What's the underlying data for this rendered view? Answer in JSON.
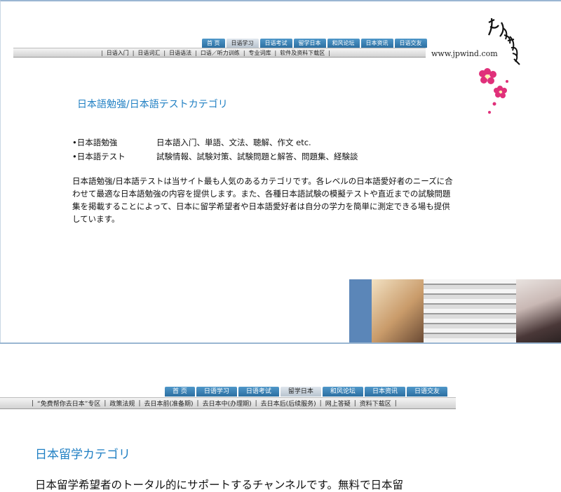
{
  "colors": {
    "tab_blue": "#2c6fa1",
    "heading_blue": "#1f7fc3",
    "blossom_pink": "#e0307a"
  },
  "logo": {
    "url_text": "www.jpwind.com"
  },
  "panel1": {
    "nav_tabs": [
      {
        "label": "首  页",
        "active": false
      },
      {
        "label": "日语学习",
        "active": true
      },
      {
        "label": "日语考试",
        "active": false
      },
      {
        "label": "留学日本",
        "active": false
      },
      {
        "label": "和风论坛",
        "active": false
      },
      {
        "label": "日本资讯",
        "active": false
      },
      {
        "label": "日语交友",
        "active": false
      }
    ],
    "sub_links": [
      "日语入门",
      "日语词汇",
      "日语语法",
      "口语／听力训练",
      "专业词库",
      "软件及资料下载区"
    ],
    "heading": "日本語勉強/日本語テストカテゴリ",
    "bullets": [
      {
        "label": "•日本語勉強",
        "items": "日本語入门、単語、文法、聴解、作文 etc."
      },
      {
        "label": "•日本語テスト",
        "items": "試験情報、試験対策、試験問題と解答、問題集、経験談"
      }
    ],
    "paragraph": "日本語勉強/日本語テストは当サイト最も人気のあるカテゴリです。各レベルの日本語愛好者のニーズに合わせて最適な日本語勉強の内容を提供します。また、各種日本語試験の模擬テストや直近までの試験問題集を掲載することによって、日本に留学希望者や日本語愛好者は自分の学力を簡単に測定できる場も提供しています。"
  },
  "panel2": {
    "nav_tabs": [
      {
        "label": "首  页",
        "active": false
      },
      {
        "label": "日语学习",
        "active": false
      },
      {
        "label": "日语考试",
        "active": false
      },
      {
        "label": "留学日本",
        "active": true
      },
      {
        "label": "和风论坛",
        "active": false
      },
      {
        "label": "日本资讯",
        "active": false
      },
      {
        "label": "日语交友",
        "active": false
      }
    ],
    "sub_links": [
      "“免费帮你去日本”专区",
      "政策法规",
      "去日本前(准备期)",
      "去日本中(办理期)",
      "去日本后(后续服务)",
      "网上答疑",
      "资料下载区"
    ],
    "heading": "日本留学カテゴリ",
    "intro": "日本留学希望者のトータル的にサポートするチャンネルです。無料で日本留"
  }
}
